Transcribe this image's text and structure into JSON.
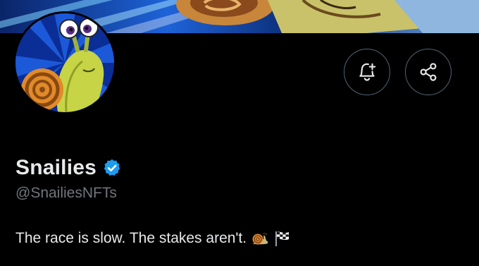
{
  "profile": {
    "display_name": "Snailies",
    "handle": "@SnailiesNFTs",
    "bio": "The race is slow. The stakes aren't.",
    "verified": true,
    "bio_emojis": [
      "snail-emoji",
      "checkered-flag-emoji"
    ]
  },
  "icons": {
    "notify": "bell-plus-icon",
    "share": "share-icon",
    "verified": "verified-badge-icon"
  },
  "colors": {
    "background": "#000000",
    "primary_text": "#e7e9ea",
    "secondary_text": "#71767b",
    "button_border": "#536471",
    "verified_blue": "#1d9bf0"
  }
}
